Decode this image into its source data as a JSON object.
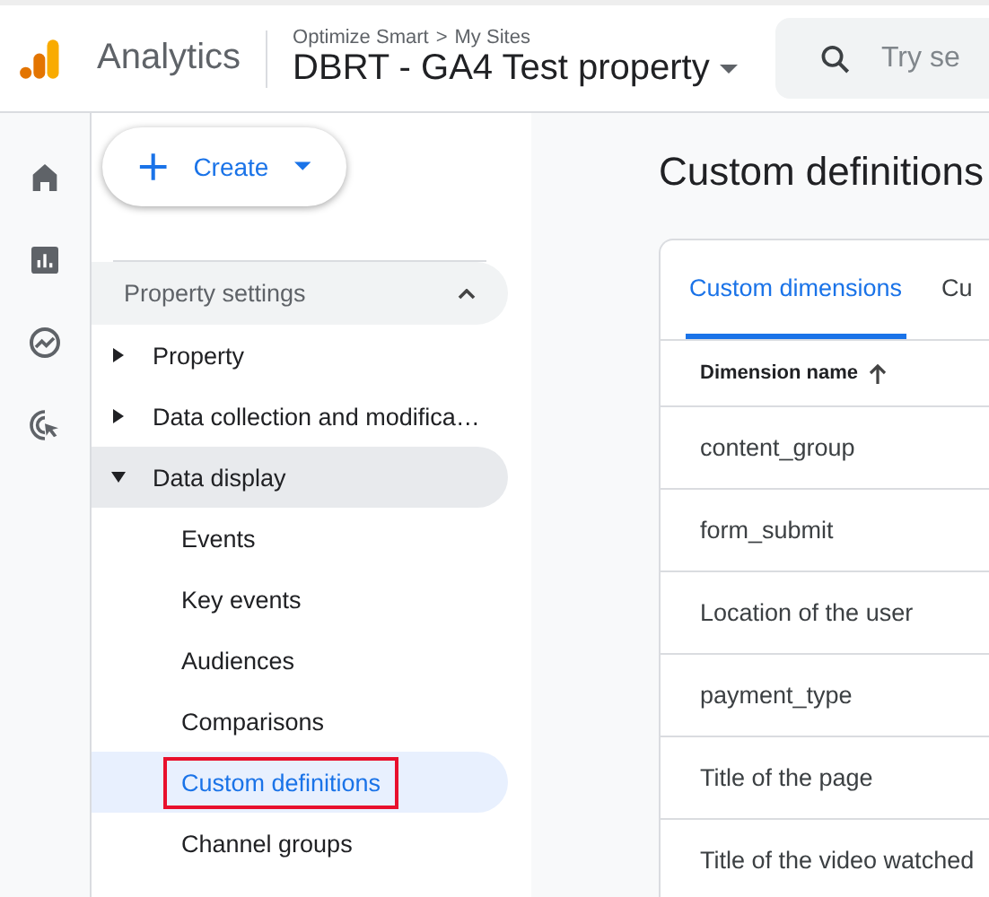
{
  "header": {
    "product": "Analytics",
    "breadcrumb": {
      "account": "Optimize Smart",
      "separator": ">",
      "site": "My Sites"
    },
    "property": "DBRT - GA4 Test property",
    "search": {
      "placeholder": "Try se"
    }
  },
  "rail": [
    {
      "kind": "home",
      "selected": false
    },
    {
      "kind": "reports",
      "selected": false
    },
    {
      "kind": "explore",
      "selected": false
    },
    {
      "kind": "advertising",
      "selected": false
    }
  ],
  "create_button": {
    "label": "Create"
  },
  "nav": {
    "section": {
      "label": "Property settings",
      "expanded": true
    },
    "items": [
      {
        "label": "Property",
        "expanded": false
      },
      {
        "label": "Data collection and modifica…",
        "expanded": false
      },
      {
        "label": "Data display",
        "expanded": true,
        "children": [
          {
            "label": "Events",
            "selected": false,
            "highlighted": false
          },
          {
            "label": "Key events",
            "selected": false,
            "highlighted": false
          },
          {
            "label": "Audiences",
            "selected": false,
            "highlighted": false
          },
          {
            "label": "Comparisons",
            "selected": false,
            "highlighted": false
          },
          {
            "label": "Custom definitions",
            "selected": true,
            "highlighted": true
          },
          {
            "label": "Channel groups",
            "selected": false,
            "highlighted": false
          }
        ]
      }
    ]
  },
  "main": {
    "title": "Custom definitions",
    "tabs": [
      {
        "label": "Custom dimensions",
        "selected": true
      },
      {
        "label": "Cu",
        "selected": false
      }
    ],
    "table": {
      "columns": [
        {
          "label": "Dimension name",
          "sorted_ascending": true
        }
      ],
      "rows": [
        "content_group",
        "form_submit",
        "Location of the user",
        "payment_type",
        "Title of the page",
        "Title of the video watched"
      ]
    }
  }
}
